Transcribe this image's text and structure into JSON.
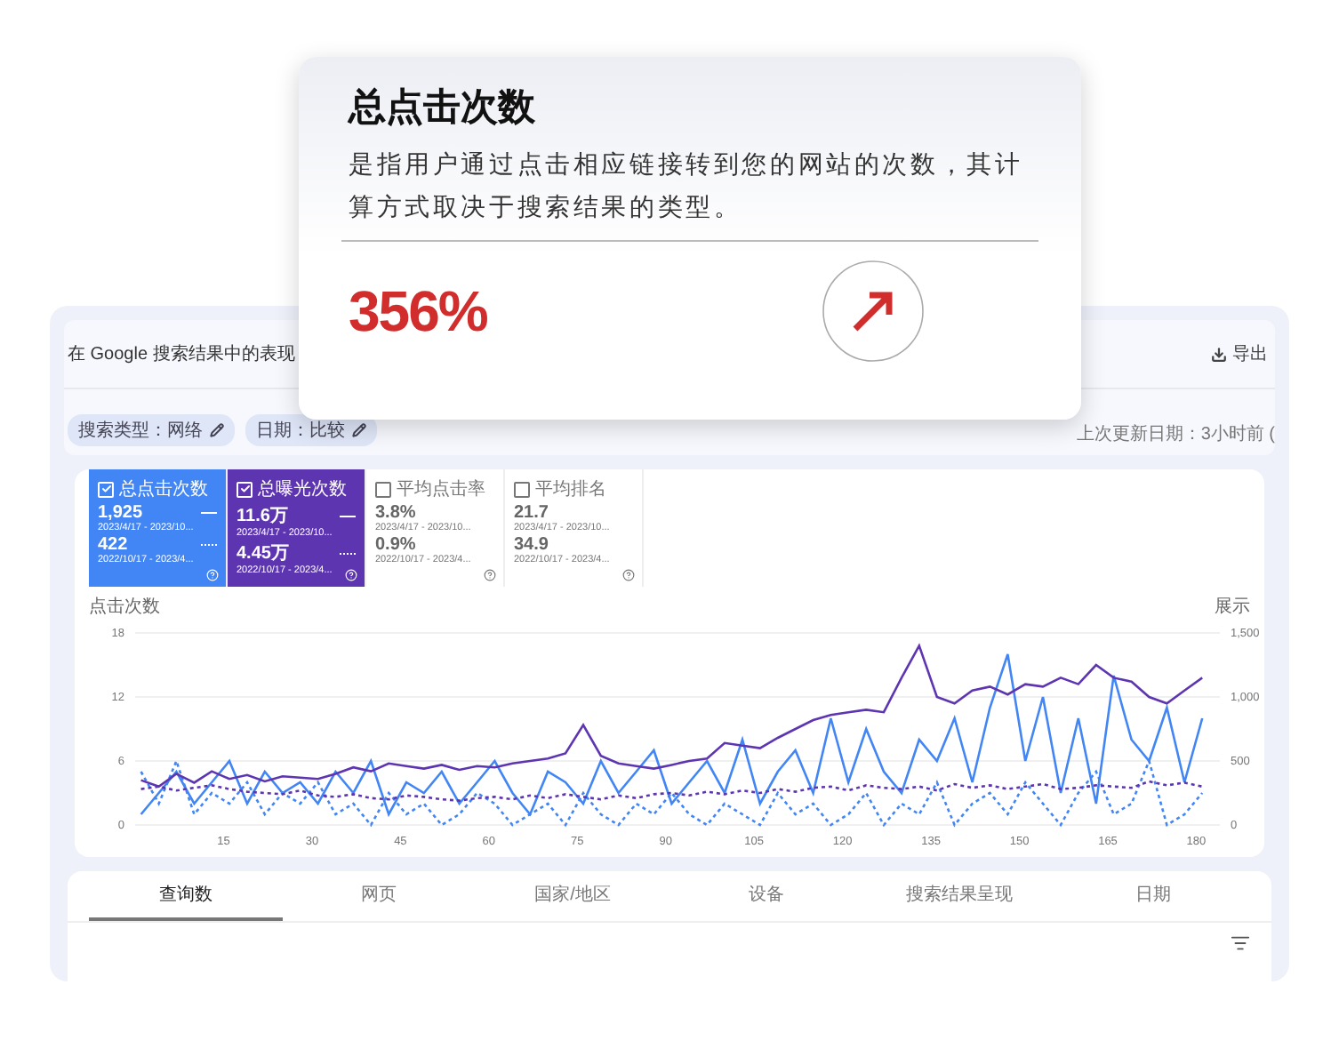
{
  "card": {
    "title": "总点击次数",
    "description": "是指用户通过点击相应链接转到您的网站的次数，其计算方式取决于搜索结果的类型。",
    "growth": "356%"
  },
  "dashboard": {
    "title": "在 Google 搜索结果中的表现",
    "export": "导出",
    "filters": [
      "搜索类型：网络",
      "日期：比较"
    ],
    "last_updated": "上次更新日期：3小时前 (",
    "metrics": [
      {
        "label": "总点击次数",
        "selected": true,
        "color": "#4285f4",
        "current": "1,925",
        "current_range": "2023/4/17 - 2023/10...",
        "previous": "422",
        "previous_range": "2022/10/17 - 2023/4..."
      },
      {
        "label": "总曝光次数",
        "selected": true,
        "color": "#5e35b1",
        "current": "11.6万",
        "current_range": "2023/4/17 - 2023/10...",
        "previous": "4.45万",
        "previous_range": "2022/10/17 - 2023/4..."
      },
      {
        "label": "平均点击率",
        "selected": false,
        "current": "3.8%",
        "current_range": "2023/4/17 - 2023/10...",
        "previous": "0.9%",
        "previous_range": "2022/10/17 - 2023/4..."
      },
      {
        "label": "平均排名",
        "selected": false,
        "current": "21.7",
        "current_range": "2023/4/17 - 2023/10...",
        "previous": "34.9",
        "previous_range": "2022/10/17 - 2023/4..."
      }
    ],
    "chart_data": {
      "type": "line",
      "ylabel": "点击次数",
      "y2label": "展示",
      "x": [
        1,
        4,
        7,
        10,
        13,
        16,
        19,
        22,
        25,
        28,
        31,
        34,
        37,
        40,
        43,
        46,
        49,
        52,
        55,
        58,
        61,
        64,
        67,
        70,
        73,
        76,
        79,
        82,
        85,
        88,
        91,
        94,
        97,
        100,
        103,
        106,
        109,
        112,
        115,
        118,
        121,
        124,
        127,
        130,
        133,
        136,
        139,
        142,
        145,
        148,
        151,
        154,
        157,
        160,
        163,
        166,
        169,
        172,
        175,
        178,
        181
      ],
      "xlim": [
        0,
        184
      ],
      "ylim": [
        0,
        18
      ],
      "y2lim": [
        0,
        1500
      ],
      "xticks": [
        15,
        30,
        45,
        60,
        75,
        90,
        105,
        120,
        135,
        150,
        165,
        180
      ],
      "yticks": [
        0,
        6,
        12,
        18
      ],
      "y2ticks": [
        0,
        {
          "value": 500,
          "label": "500"
        },
        {
          "value": 1000,
          "label": "1,000"
        },
        {
          "value": 1500,
          "label": "1,500"
        }
      ],
      "series": [
        {
          "color": "#4285f4",
          "line_style": "solid",
          "values": [
            1,
            3,
            5,
            2,
            4,
            6,
            2,
            5,
            3,
            4,
            2,
            5,
            3,
            6,
            1,
            4,
            3,
            5,
            2,
            4,
            6,
            3,
            1,
            5,
            4,
            2,
            6,
            3,
            5,
            7,
            2,
            4,
            6,
            3,
            8,
            2,
            5,
            7,
            3,
            10,
            4,
            9,
            5,
            3,
            8,
            6,
            10,
            4,
            11,
            16,
            6,
            12,
            3,
            10,
            2,
            14,
            8,
            6,
            11,
            4,
            10
          ]
        },
        {
          "color": "#4285f4",
          "line_style": "dashed",
          "values": [
            5,
            2,
            6,
            1,
            3,
            2,
            4,
            1,
            3,
            2,
            4,
            1,
            2,
            0,
            3,
            1,
            2,
            0,
            1,
            3,
            2,
            0,
            1,
            2,
            0,
            3,
            1,
            0,
            2,
            1,
            3,
            1,
            0,
            2,
            1,
            0,
            3,
            1,
            2,
            0,
            1,
            3,
            0,
            2,
            1,
            4,
            0,
            2,
            3,
            1,
            4,
            2,
            0,
            3,
            5,
            1,
            2,
            6,
            0,
            1,
            3
          ]
        },
        {
          "color": "#5e35b1",
          "axis": "y2",
          "line_style": "solid",
          "values": [
            350,
            300,
            400,
            330,
            420,
            360,
            390,
            340,
            380,
            370,
            360,
            400,
            450,
            420,
            480,
            460,
            440,
            470,
            430,
            460,
            450,
            480,
            500,
            520,
            560,
            780,
            540,
            480,
            460,
            440,
            470,
            500,
            520,
            640,
            620,
            600,
            680,
            750,
            820,
            860,
            880,
            900,
            880,
            1150,
            1400,
            1000,
            950,
            1050,
            1080,
            1020,
            1100,
            1080,
            1150,
            1100,
            1250,
            1150,
            1120,
            1000,
            950,
            1050,
            1150
          ]
        },
        {
          "color": "#5e35b1",
          "axis": "y2",
          "line_style": "dashed",
          "values": [
            280,
            300,
            270,
            290,
            310,
            280,
            260,
            250,
            240,
            270,
            230,
            220,
            240,
            210,
            200,
            230,
            220,
            200,
            190,
            210,
            220,
            200,
            230,
            210,
            240,
            220,
            200,
            230,
            210,
            240,
            250,
            230,
            260,
            240,
            270,
            250,
            280,
            260,
            290,
            300,
            270,
            310,
            290,
            280,
            300,
            270,
            320,
            290,
            310,
            280,
            300,
            320,
            280,
            290,
            310,
            300,
            290,
            340,
            310,
            330,
            300
          ]
        }
      ]
    },
    "tabs": [
      {
        "label": "查询数",
        "selected": true
      },
      {
        "label": "网页",
        "selected": false
      },
      {
        "label": "国家/地区",
        "selected": false
      },
      {
        "label": "设备",
        "selected": false
      },
      {
        "label": "搜索结果呈现",
        "selected": false
      },
      {
        "label": "日期",
        "selected": false
      }
    ]
  }
}
